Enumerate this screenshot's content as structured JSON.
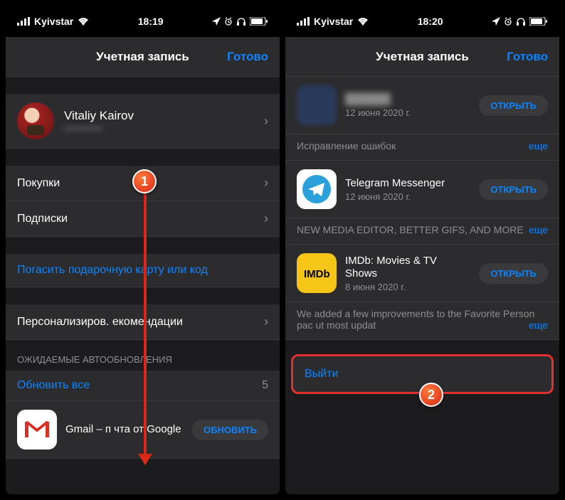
{
  "left": {
    "status": {
      "carrier": "Kyivstar",
      "time": "18:19"
    },
    "header": {
      "title": "Учетная запись",
      "done": "Готово"
    },
    "user": {
      "name": "Vitaliy Kairov",
      "sub": "••••••••••••"
    },
    "rows": {
      "purchases": "Покупки",
      "subscriptions": "Подписки",
      "redeem": "Погасить подарочную карту или код",
      "personalized": "Персонализиров.  екомендации"
    },
    "updates": {
      "header": "Ожидаемые автообновления",
      "updateAll": "Обновить все",
      "count": "5"
    },
    "gmail": {
      "name": "Gmail – п  чта от Google",
      "btn": "Обновить"
    }
  },
  "right": {
    "status": {
      "carrier": "Kyivstar",
      "time": "18:20"
    },
    "header": {
      "title": "Учетная запись",
      "done": "Готово"
    },
    "app1": {
      "name": "██████",
      "date": "12 июня 2020 г.",
      "btn": "Открыть",
      "notes": "Исправление ошибок",
      "more": "еще"
    },
    "app2": {
      "name": "Telegram Messenger",
      "date": "12 июня 2020 г.",
      "btn": "Открыть",
      "notes": "NEW MEDIA EDITOR, BETTER GIFS, AND MORE",
      "more": "еще"
    },
    "app3": {
      "name": "IMDb: Movies & TV Shows",
      "date": "8 июня 2020 г.",
      "btn": "Открыть",
      "notes": "We added a few improvements to the Favorite Person pac    ut most updat",
      "more": "еще"
    },
    "signout": "Выйти"
  },
  "badges": {
    "one": "1",
    "two": "2"
  }
}
